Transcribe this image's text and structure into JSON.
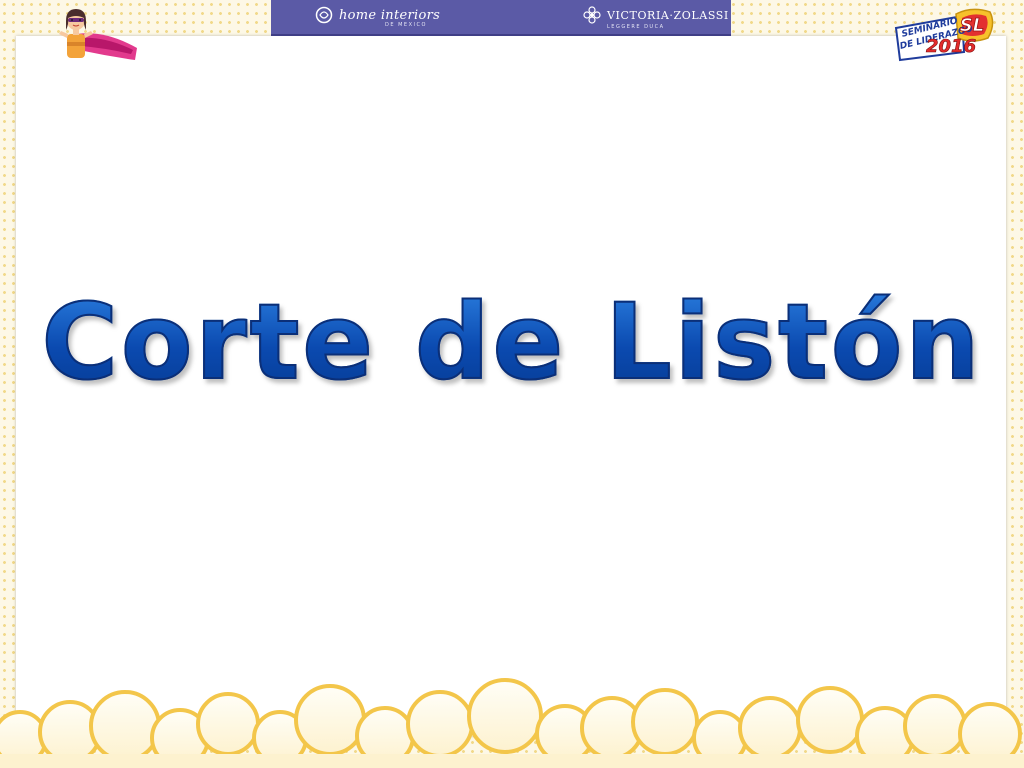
{
  "header": {
    "brand_left": "home interiors",
    "brand_left_sub": "DE MEXICO",
    "brand_right": "VICTORIA·ZOLASSI",
    "brand_right_sub": "LEGGERE DUCA"
  },
  "badge": {
    "line1": "SEMINARIO",
    "line2": "DE LIDERAZGO",
    "year": "2016",
    "initials": "SL"
  },
  "slide": {
    "title": "Corte de Listón"
  },
  "colors": {
    "title_blue": "#0d4fb0",
    "header_purple": "#5b5aa6",
    "cloud_yellow": "#f3c64a",
    "dot_yellow": "#f1d98a"
  }
}
